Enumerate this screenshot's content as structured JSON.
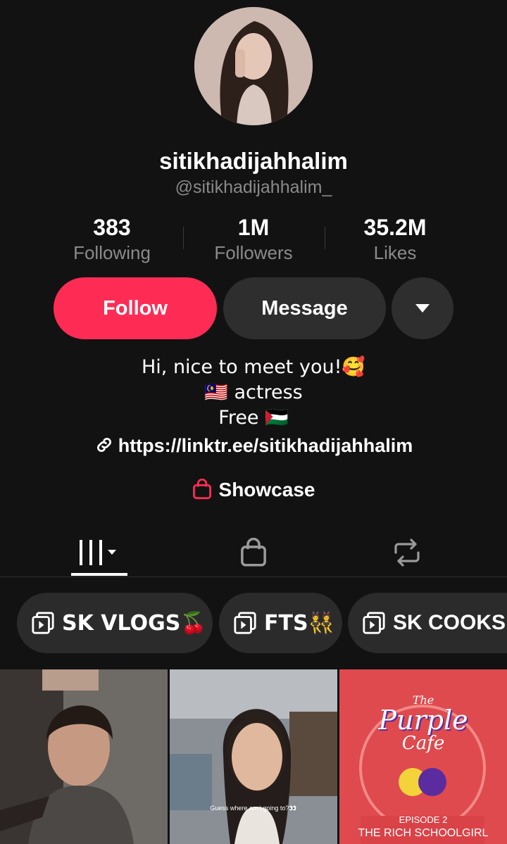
{
  "profile": {
    "display_name": "sitikhadijahhalim",
    "handle": "@sitikhadijahhalim_"
  },
  "stats": [
    {
      "value": "383",
      "label": "Following"
    },
    {
      "value": "1M",
      "label": "Followers"
    },
    {
      "value": "35.2M",
      "label": "Likes"
    }
  ],
  "actions": {
    "follow": "Follow",
    "message": "Message"
  },
  "bio": {
    "line1": "Hi, nice to meet you!🥰",
    "line2": "🇲🇾 actress",
    "line3": "Free 🇵🇸",
    "link": "https://linktr.ee/sitikhadijahhalim"
  },
  "showcase": "Showcase",
  "tabs": [
    "videos-grid-icon",
    "shop-bag-icon",
    "repost-icon"
  ],
  "playlists": [
    {
      "label": "SK VLOGS🍒"
    },
    {
      "label": "FTS👯"
    },
    {
      "label": "SK COOKS"
    }
  ],
  "videos": [
    {
      "caption": ""
    },
    {
      "caption": "Guess where am i going to?👀"
    },
    {
      "title_top": "The",
      "title_main": "Purple",
      "title_sub": "Cafe",
      "episode": "EPISODE 2",
      "episode_title": "THE RICH SCHOOLGIRL"
    }
  ],
  "colors": {
    "accent": "#fe2c55",
    "background": "#121212",
    "surface": "#2e2e2e"
  }
}
